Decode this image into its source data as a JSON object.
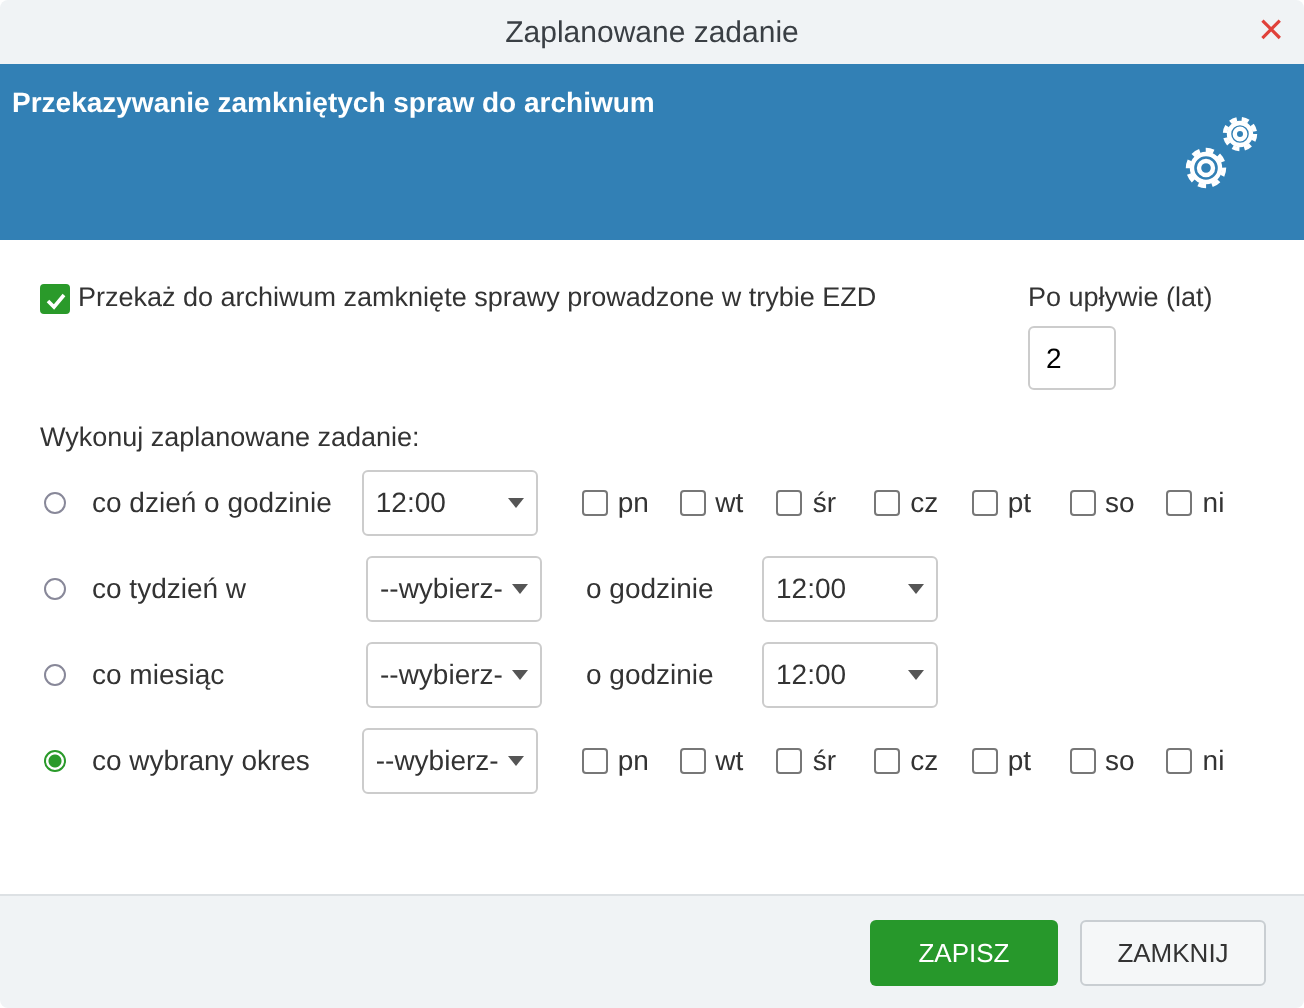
{
  "window": {
    "title": "Zaplanowane zadanie",
    "close": "×"
  },
  "header": {
    "title": "Przekazywanie zamkniętych spraw do archiwum"
  },
  "archive": {
    "label": "Przekaż do archiwum zamknięte sprawy prowadzone w trybie EZD",
    "checked": true
  },
  "years": {
    "label": "Po upływie (lat)",
    "value": "2"
  },
  "schedule_label": "Wykonuj zaplanowane zadanie:",
  "schedule": [
    {
      "kind": "days",
      "label": "co dzień o godzinie",
      "selected": false,
      "select": "12:00",
      "days": [
        {
          "label": "pn",
          "checked": false
        },
        {
          "label": "wt",
          "checked": false
        },
        {
          "label": "śr",
          "checked": false
        },
        {
          "label": "cz",
          "checked": false
        },
        {
          "label": "pt",
          "checked": false
        },
        {
          "label": "so",
          "checked": false
        },
        {
          "label": "ni",
          "checked": false
        }
      ]
    },
    {
      "kind": "time",
      "label": "co tydzień w",
      "selected": false,
      "select": "--wybierz-",
      "time_label": "o godzinie",
      "time": "12:00"
    },
    {
      "kind": "time",
      "label": "co miesiąc",
      "selected": false,
      "select": "--wybierz-",
      "time_label": "o godzinie",
      "time": "12:00"
    },
    {
      "kind": "days",
      "label": "co wybrany okres",
      "selected": true,
      "select": "--wybierz-",
      "days": [
        {
          "label": "pn",
          "checked": false
        },
        {
          "label": "wt",
          "checked": false
        },
        {
          "label": "śr",
          "checked": false
        },
        {
          "label": "cz",
          "checked": false
        },
        {
          "label": "pt",
          "checked": false
        },
        {
          "label": "so",
          "checked": false
        },
        {
          "label": "ni",
          "checked": false
        }
      ]
    }
  ],
  "buttons": [
    {
      "label": "ZAPISZ",
      "kind": "primary"
    },
    {
      "label": "ZAMKNIJ",
      "kind": "secondary"
    }
  ]
}
